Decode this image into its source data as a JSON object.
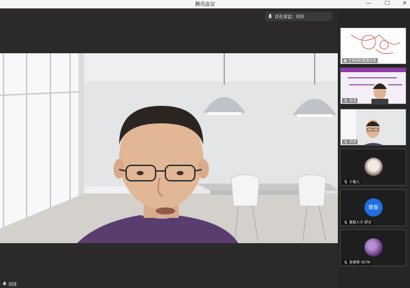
{
  "window": {
    "title": "腾讯会议",
    "minimize": "—",
    "maximize": "☐",
    "close": "✕"
  },
  "speaking": {
    "label": "正在讲话：刘洋",
    "icon": "mic-icon"
  },
  "main_video": {
    "name": "刘洋"
  },
  "participants": [
    {
      "name": "王老师的屏幕共享",
      "type": "screen-share"
    },
    {
      "name": "刘洋",
      "type": "slide"
    },
    {
      "name": "刘洋",
      "type": "camera"
    },
    {
      "name": "小鱼儿",
      "type": "avatar"
    },
    {
      "name": "数智人才 研讨",
      "type": "avatar",
      "initials": "数智"
    },
    {
      "name": "张老师 OCTA",
      "type": "avatar"
    }
  ],
  "colors": {
    "accent": "#1f6fe0",
    "sidebar": "#262626",
    "slide_bar": "#8e3ca6"
  }
}
